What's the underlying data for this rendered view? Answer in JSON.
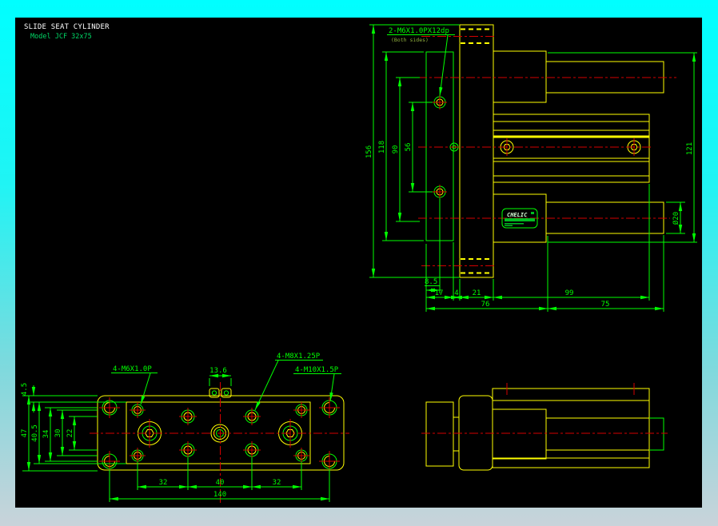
{
  "window": {
    "title_line1": "SLIDE SEAT CYLINDER",
    "title_line2": "Model  JCF 32x75"
  },
  "logo": {
    "brand": "CHELIC"
  },
  "side_view": {
    "callout_thread": "2-M6X1.0PX12dp",
    "callout_thread_note": "(Both sides)",
    "dims": {
      "overall_height": "156",
      "plate_height": "118",
      "port_center_span": "90",
      "mount_hole_span": "56",
      "body_height": "121",
      "rod_diameter": "Ø20",
      "hole_offset": "8.5",
      "plate_thickness": "17",
      "spacer_gap": "4",
      "flange_thickness": "21",
      "body_length": "99",
      "front_length": "76",
      "rear_length": "75"
    }
  },
  "plan_view": {
    "callout_m6": "4-M6X1.0P",
    "callout_sensor_slot": "13.6",
    "callout_m8": "4-M8X1.25P",
    "callout_m10": "4-M10X1.5P",
    "dims": {
      "edge_lip": "4.5",
      "plate_width": "47",
      "inner_width": "40.5",
      "m10_row_span": "34",
      "m6_row_span": "30",
      "m8_row_span": "22",
      "pitch_a": "32",
      "pitch_b": "40",
      "pitch_c": "32",
      "total_pitch": "140"
    }
  },
  "colors": {
    "canvas_bg": "#000000",
    "outline": "#ffff00",
    "dimension": "#00ff00",
    "centerline": "#d40000",
    "title_text": "#ffffff",
    "model_text": "#00d866",
    "desktop_top": "#00ffff",
    "desktop_bottom": "#c9d3da"
  }
}
